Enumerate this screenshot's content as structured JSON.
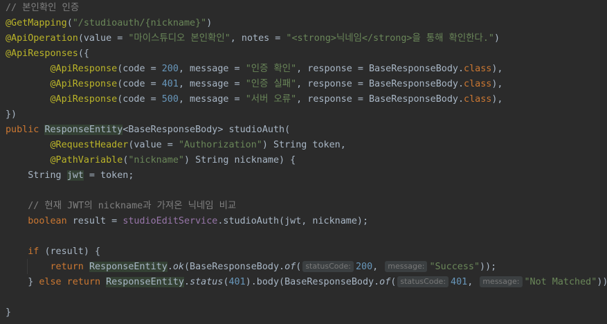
{
  "editor": {
    "lines": [
      [
        {
          "t": "// 본인확인 인증",
          "c": "comment"
        }
      ],
      [
        {
          "t": "@GetMapping",
          "c": "annotation"
        },
        {
          "t": "(",
          "c": "plain"
        },
        {
          "t": "\"/studioauth/{nickname}\"",
          "c": "string"
        },
        {
          "t": ")",
          "c": "plain"
        }
      ],
      [
        {
          "t": "@ApiOperation",
          "c": "annotation"
        },
        {
          "t": "(value = ",
          "c": "plain"
        },
        {
          "t": "\"마이스튜디오 본인확인\"",
          "c": "string"
        },
        {
          "t": ", notes = ",
          "c": "plain"
        },
        {
          "t": "\"<strong>닉네임</strong>을 통해 확인한다.\"",
          "c": "string"
        },
        {
          "t": ")",
          "c": "plain"
        }
      ],
      [
        {
          "t": "@ApiResponses",
          "c": "annotation"
        },
        {
          "t": "({",
          "c": "plain"
        }
      ],
      [
        {
          "t": "        ",
          "c": "plain"
        },
        {
          "t": "@ApiResponse",
          "c": "annotation"
        },
        {
          "t": "(code = ",
          "c": "plain"
        },
        {
          "t": "200",
          "c": "number"
        },
        {
          "t": ", message = ",
          "c": "plain"
        },
        {
          "t": "\"인증 확인\"",
          "c": "string"
        },
        {
          "t": ", response = BaseResponseBody.",
          "c": "plain"
        },
        {
          "t": "class",
          "c": "keyword"
        },
        {
          "t": "),",
          "c": "plain"
        }
      ],
      [
        {
          "t": "        ",
          "c": "plain"
        },
        {
          "t": "@ApiResponse",
          "c": "annotation"
        },
        {
          "t": "(code = ",
          "c": "plain"
        },
        {
          "t": "401",
          "c": "number"
        },
        {
          "t": ", message = ",
          "c": "plain"
        },
        {
          "t": "\"인증 실패\"",
          "c": "string"
        },
        {
          "t": ", response = BaseResponseBody.",
          "c": "plain"
        },
        {
          "t": "class",
          "c": "keyword"
        },
        {
          "t": "),",
          "c": "plain"
        }
      ],
      [
        {
          "t": "        ",
          "c": "plain"
        },
        {
          "t": "@ApiResponse",
          "c": "annotation"
        },
        {
          "t": "(code = ",
          "c": "plain"
        },
        {
          "t": "500",
          "c": "number"
        },
        {
          "t": ", message = ",
          "c": "plain"
        },
        {
          "t": "\"서버 오류\"",
          "c": "string"
        },
        {
          "t": ", response = BaseResponseBody.",
          "c": "plain"
        },
        {
          "t": "class",
          "c": "keyword"
        },
        {
          "t": "),",
          "c": "plain"
        }
      ],
      [
        {
          "t": "})",
          "c": "plain"
        }
      ],
      [
        {
          "t": "public ",
          "c": "keyword"
        },
        {
          "t": "ResponseEntity",
          "c": "plain hl"
        },
        {
          "t": "<BaseResponseBody> ",
          "c": "plain"
        },
        {
          "t": "studioAuth",
          "c": "plain"
        },
        {
          "t": "(",
          "c": "plain"
        }
      ],
      [
        {
          "t": "        ",
          "c": "plain"
        },
        {
          "t": "@RequestHeader",
          "c": "annotation"
        },
        {
          "t": "(value = ",
          "c": "plain"
        },
        {
          "t": "\"Authorization\"",
          "c": "string"
        },
        {
          "t": ") String token,",
          "c": "plain"
        }
      ],
      [
        {
          "t": "        ",
          "c": "plain"
        },
        {
          "t": "@PathVariable",
          "c": "annotation"
        },
        {
          "t": "(",
          "c": "plain"
        },
        {
          "t": "\"nickname\"",
          "c": "string"
        },
        {
          "t": ") String nickname) {",
          "c": "plain"
        }
      ],
      [
        {
          "t": "    String ",
          "c": "plain"
        },
        {
          "t": "jwt",
          "c": "plain hl"
        },
        {
          "t": " = token;",
          "c": "plain"
        }
      ],
      [],
      [
        {
          "t": "    // 현재 JWT의 nickname과 가져온 닉네임 비교",
          "c": "comment"
        }
      ],
      [
        {
          "t": "    ",
          "c": "plain"
        },
        {
          "t": "boolean ",
          "c": "keyword"
        },
        {
          "t": "result = ",
          "c": "plain"
        },
        {
          "t": "studioEditService",
          "c": "field"
        },
        {
          "t": ".studioAuth(jwt, nickname);",
          "c": "plain"
        }
      ],
      [],
      [
        {
          "t": "    ",
          "c": "plain"
        },
        {
          "t": "if ",
          "c": "keyword"
        },
        {
          "t": "(result) {",
          "c": "plain"
        }
      ],
      [
        {
          "t": "        ",
          "c": "plain"
        },
        {
          "t": "return ",
          "c": "keyword"
        },
        {
          "t": "ResponseEntity",
          "c": "plain hl"
        },
        {
          "t": ".",
          "c": "plain"
        },
        {
          "t": "ok",
          "c": "static"
        },
        {
          "t": "(BaseResponseBody.",
          "c": "plain"
        },
        {
          "t": "of",
          "c": "static"
        },
        {
          "t": "(",
          "c": "plain"
        },
        {
          "h": "statusCode:"
        },
        {
          "t": "200",
          "c": "number"
        },
        {
          "t": ", ",
          "c": "plain"
        },
        {
          "h": "message:"
        },
        {
          "t": "\"Success\"",
          "c": "string"
        },
        {
          "t": "));",
          "c": "plain"
        }
      ],
      [
        {
          "t": "    } ",
          "c": "plain"
        },
        {
          "t": "else return ",
          "c": "keyword"
        },
        {
          "t": "ResponseEntity",
          "c": "plain hl"
        },
        {
          "t": ".",
          "c": "plain"
        },
        {
          "t": "status",
          "c": "static"
        },
        {
          "t": "(",
          "c": "plain"
        },
        {
          "t": "401",
          "c": "number"
        },
        {
          "t": ").body(BaseResponseBody.",
          "c": "plain"
        },
        {
          "t": "of",
          "c": "static"
        },
        {
          "t": "(",
          "c": "plain"
        },
        {
          "h": "statusCode:"
        },
        {
          "t": "401",
          "c": "number"
        },
        {
          "t": ", ",
          "c": "plain"
        },
        {
          "h": "message:"
        },
        {
          "t": "\"Not Matched\"",
          "c": "string"
        },
        {
          "t": "));",
          "c": "plain"
        }
      ],
      [],
      [
        {
          "t": "}",
          "c": "plain"
        }
      ]
    ]
  },
  "colors": {
    "background": "#2b2b2b",
    "comment": "#808080",
    "annotation": "#bbb529",
    "string": "#6a8759",
    "number": "#6897bb",
    "keyword": "#cc7832",
    "plain": "#a9b7c6",
    "field": "#9876aa",
    "hint_bg": "#3b3f41",
    "hint_fg": "#787878",
    "highlight": "#344134"
  }
}
